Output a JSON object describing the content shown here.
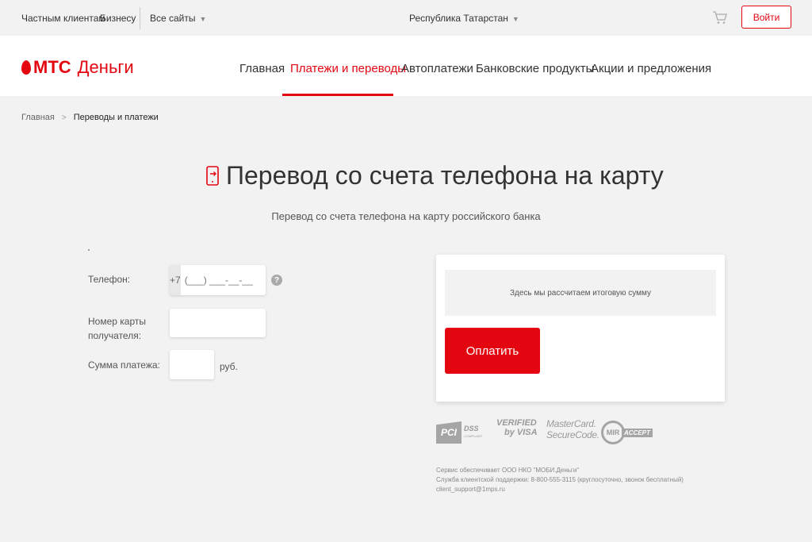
{
  "topbar": {
    "private_clients": "Частным клиентам",
    "business": "Бизнесу",
    "all_sites": "Все сайты",
    "region": "Республика Татарстан",
    "login": "Войти"
  },
  "header": {
    "logo_mts": "МТС",
    "logo_money": "Деньги",
    "nav": [
      "Главная",
      "Платежи и переводы",
      "Автоплатежи",
      "Банковские продукты",
      "Акции и предложения"
    ],
    "active_nav": "Платежи и переводы"
  },
  "breadcrumb": {
    "home": "Главная",
    "current": "Переводы и платежи"
  },
  "page": {
    "title": "Перевод со счета телефона на карту",
    "subtitle": "Перевод со счета телефона на карту российского банка"
  },
  "form": {
    "phone_label": "Телефон:",
    "phone_prefix": "+7",
    "phone_mask": "(___) ___-__-__",
    "help": "?",
    "card_label_line1": "Номер карты",
    "card_label_line2": "получателя:",
    "card_value": "",
    "sum_label": "Сумма платежа:",
    "sum_value": "",
    "currency": "руб."
  },
  "pay_panel": {
    "total_hint": "Здесь мы рассчитаем итоговую сумму",
    "pay_button": "Оплатить"
  },
  "security_logos": {
    "pci_box": "PCI",
    "pci_text": "DSS",
    "pci_small": "COMPLIANT",
    "verified_line1": "VERIFIED",
    "verified_line2": "by VISA",
    "mastercard_line1": "MasterCard.",
    "mastercard_line2": "SecureCode.",
    "mir": "MIR",
    "mir_accept": "ACCEPT"
  },
  "footer": {
    "line1": "Сервис обеспечивает ООО НКО \"МОБИ.Деньги\"",
    "line2": "Служба клиентской поддержки: 8-800-555-3115 (круглосуточно, звонок бесплатный)",
    "line3": "client_support@1mps.ru"
  },
  "colors": {
    "brand": "#e30611",
    "background": "#f2f2f2"
  }
}
